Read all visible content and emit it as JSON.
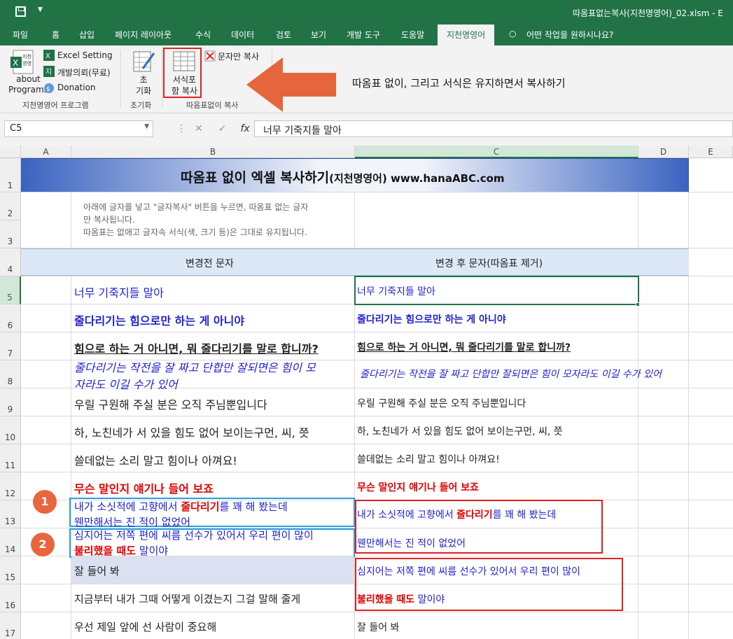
{
  "window": {
    "document_title": "따옴표없는복사(지천명영어)_02.xlsm  -  E"
  },
  "tabs": [
    "파일",
    "홈",
    "삽입",
    "페이지 레이아웃",
    "수식",
    "데이터",
    "검토",
    "보기",
    "개발 도구",
    "도움말",
    "지천명영어"
  ],
  "tell_me": "어떤 작업을 원하시나요?",
  "ribbon": {
    "about_label": "about\nPrograms",
    "excel_setting": "Excel Setting",
    "dev_request": "개발의뢰(무료)",
    "donation": "Donation",
    "group1": "지천명영어 프로그램",
    "init_label": "초\n기화",
    "group2": "초기화",
    "format_copy": "서식포\n함 복사",
    "text_only_copy": "문자만 복사",
    "group3": "따옴표없이 복사"
  },
  "annotation": "따옴표 없이, 그리고 서식은 유지하면서 복사하기",
  "formula_bar": {
    "name_box": "C5",
    "fx": "fx",
    "formula": "너무 기죽지들 말아"
  },
  "columns": [
    "A",
    "B",
    "C",
    "D",
    "E"
  ],
  "rows": [
    "1",
    "2",
    "3",
    "4",
    "5",
    "6",
    "7",
    "8",
    "9",
    "10",
    "11",
    "12",
    "13",
    "14",
    "15",
    "16",
    "17"
  ],
  "sheet": {
    "title_main": "따옴표 없이 엑셀 복사하기",
    "title_sub": "(지천명영어) www.hanaABC.com",
    "note1": "아래에 글자를 넣고 \"글자복사\" 버튼을 누르면, 따옴표 없는 글자",
    "note2": "만 복사됩니다.",
    "note3": "따옴표는 없애고 글자속 서식(색, 크기 등)은 그대로 유지됩니다.",
    "hdr_before": "변경전 문자",
    "hdr_after": "변경 후 문자(따옴표 제거)",
    "r5": "너무 기죽지들 말아",
    "r6": "줄다리기는 힘으로만 하는 게 아니야",
    "r7": "힘으로 하는 거 아니면, 뭐 줄다리기를 말로 합니까?",
    "r8a": "줄다리기는 작전을 잘 짜고  단합만 잘되면은  힘이  모",
    "r8b": "자라도  이길  수가  있어",
    "r8c": "줄다리기는 작전을 잘 짜고  단합만 잘되면은 힘이 모자라도  이길  수가  있어",
    "r9": "우릴 구원해 주실 분은 오직 주님뿐입니다",
    "r10": "하, 노친네가 서 있을 힘도 없어 보이는구먼, 씨, 쯧",
    "r11": "쓸데없는 소리 말고 힘이나 아껴요!",
    "r12": "무슨 말인지 얘기나 들어 보죠",
    "r13_pre": "내가 소싯적에 고향에서 ",
    "r13_red": "줄다리기",
    "r13_post": "를 꽤 해 봤는데",
    "r13_line2": "웬만해서는 진 적이 없었어",
    "r14_line1": "심지어는 저쪽 편에 씨름 선수가 있어서 우리 편이 많이",
    "r14_red": "불리했을 때도",
    "r14_post": " 말이야",
    "r15": "잘 들어 봐",
    "r16": "지금부터 내가 그때 어떻게 이겼는지 그걸 말해 줄게",
    "r17": "우선 제일 앞에 선 사람이 중요해"
  },
  "badges": [
    "1",
    "2"
  ]
}
